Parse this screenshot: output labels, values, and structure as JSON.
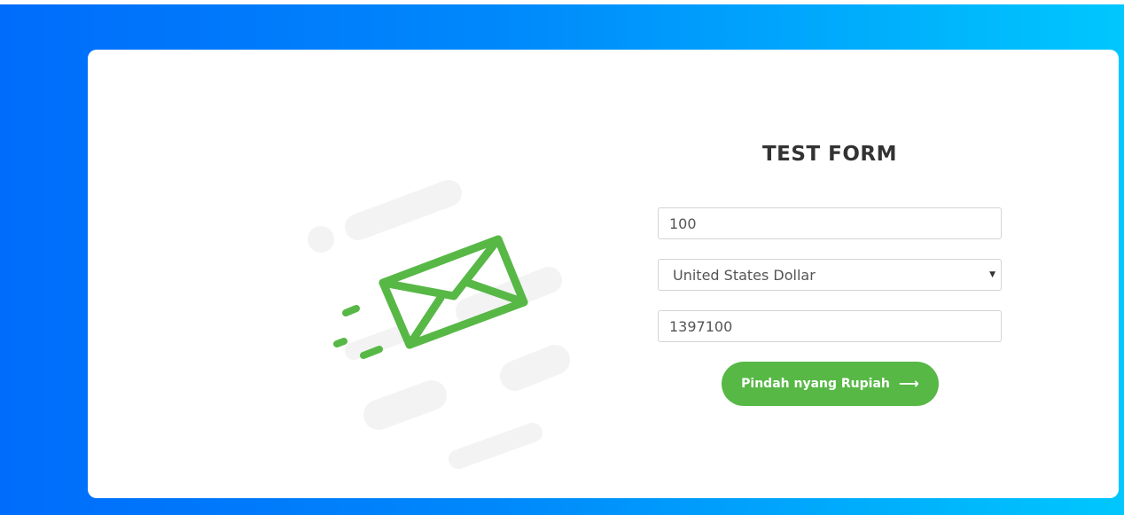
{
  "form": {
    "title": "TEST FORM",
    "amount_value": "100",
    "currency_selected": "United States Dollar",
    "result_value": "1397100",
    "submit_label": "Pindah nyang Rupiah",
    "submit_icon": "arrow-right-icon"
  },
  "illustration": {
    "icon": "envelope-icon",
    "accent_color": "#57b846"
  },
  "colors": {
    "gradient_start": "#006cfb",
    "gradient_end": "#00c7fd",
    "button": "#57b846",
    "title": "#333333"
  }
}
